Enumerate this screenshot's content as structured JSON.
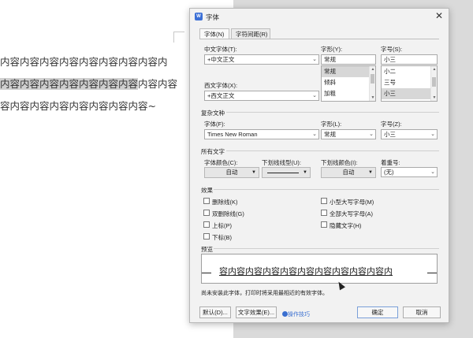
{
  "document": {
    "lines": [
      "内容内容内容内容内容内容内容内容内",
      "容内容内容内容内容内容内容内容内容",
      "容内容内容内容内容内容内容内容~"
    ],
    "highlight": "内容内容内容内容内容内容内容"
  },
  "dialog": {
    "title": "字体",
    "close_glyph": "✕",
    "tabs": [
      {
        "label": "字体(N)",
        "active": true
      },
      {
        "label": "字符间距(R)",
        "active": false
      }
    ],
    "chinese_font": {
      "label": "中文字体(T):",
      "value": "+中文正文"
    },
    "western_font": {
      "label": "西文字体(X):",
      "value": "+西文正文"
    },
    "style": {
      "label": "字形(Y):",
      "value": "常规",
      "options": [
        "常规",
        "倾斜",
        "加粗"
      ],
      "selected_index": 0
    },
    "size": {
      "label": "字号(S):",
      "value": "小三",
      "options": [
        "小二",
        "三号",
        "小三"
      ],
      "selected_index": 2
    },
    "complex": {
      "group_title": "复杂文种",
      "font_label": "字体(F):",
      "font_value": "Times New Roman",
      "style_label": "字形(L):",
      "style_value": "常规",
      "size_label": "字号(Z):",
      "size_value": "小三"
    },
    "all_text": {
      "group_title": "所有文字",
      "color_label": "字体颜色(C):",
      "color_value": "自动",
      "underline_type_label": "下划线线型(U):",
      "underline_color_label": "下划线颜色(I):",
      "underline_color_value": "自动",
      "emphasis_label": "着重号:",
      "emphasis_value": "(无)"
    },
    "effects": {
      "group_title": "效果",
      "left": [
        "删除线(K)",
        "双删除线(G)",
        "上标(P)",
        "下标(B)"
      ],
      "right": [
        "小型大写字母(M)",
        "全部大写字母(A)",
        "隐藏文字(H)"
      ]
    },
    "preview": {
      "group_title": "预览",
      "sample_text": "容内容内容内容内容内容内容内容内容内容内"
    },
    "note": "尚未安装此字体，打印时将采用最相近的有效字体。",
    "buttons": {
      "default": "默认(D)...",
      "text_effects": "文字效果(E)...",
      "tips": "操作技巧",
      "ok": "确定",
      "cancel": "取消"
    },
    "accent_color": "#3a6fd0"
  }
}
